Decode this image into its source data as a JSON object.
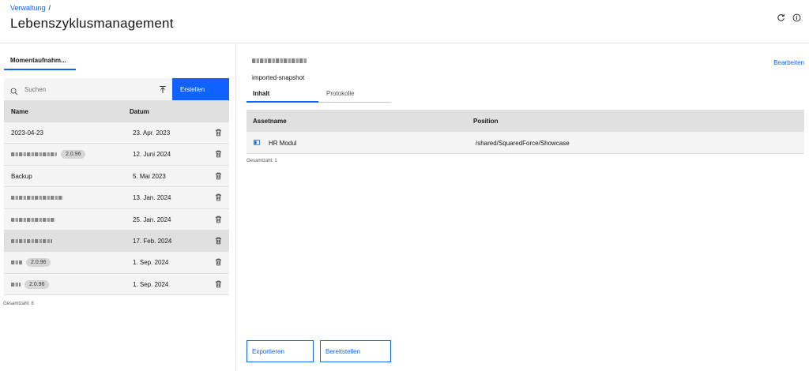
{
  "header": {
    "breadcrumb_link": "Verwaltung",
    "breadcrumb_sep": "/",
    "title": "Lebenszyklusmanagement",
    "icons": [
      "refresh-icon",
      "info-icon"
    ]
  },
  "left": {
    "tab_label": "Momentaufnahm...",
    "search_placeholder": "Suchen",
    "create_label": "Erstellen",
    "columns": {
      "name": "Name",
      "date": "Datum"
    },
    "rows": [
      {
        "name": "2023-04-23",
        "tag": "",
        "date": "23. Apr. 2023"
      },
      {
        "name": "",
        "tag": "2.0.96",
        "date": "12. Juni 2024"
      },
      {
        "name": "Backup",
        "tag": "",
        "date": "5. Mai 2023"
      },
      {
        "name": "",
        "tag": "",
        "date": "13. Jan. 2024"
      },
      {
        "name": "",
        "tag": "",
        "date": "25. Jan. 2024"
      },
      {
        "name": "",
        "tag": "",
        "date": "17. Feb. 2024"
      },
      {
        "name": "",
        "tag": "2.0.96",
        "date": "1. Sep. 2024"
      },
      {
        "name": "",
        "tag": "2.0.96",
        "date": "1. Sep. 2024"
      }
    ],
    "total": "Gesamtzahl: 8"
  },
  "right": {
    "subtitle": "imported-snapshot",
    "edit_label": "Bearbeiten",
    "tabs": [
      "Inhalt",
      "Protokolle"
    ],
    "columns": {
      "asset": "Assetname",
      "position": "Position"
    },
    "rows": [
      {
        "asset": "HR Modul",
        "position": "/shared/SquaredForce/Showcase"
      }
    ],
    "total": "Gesamtzahl: 1",
    "export_label": "Exportieren",
    "deploy_label": "Bereitstellen"
  }
}
